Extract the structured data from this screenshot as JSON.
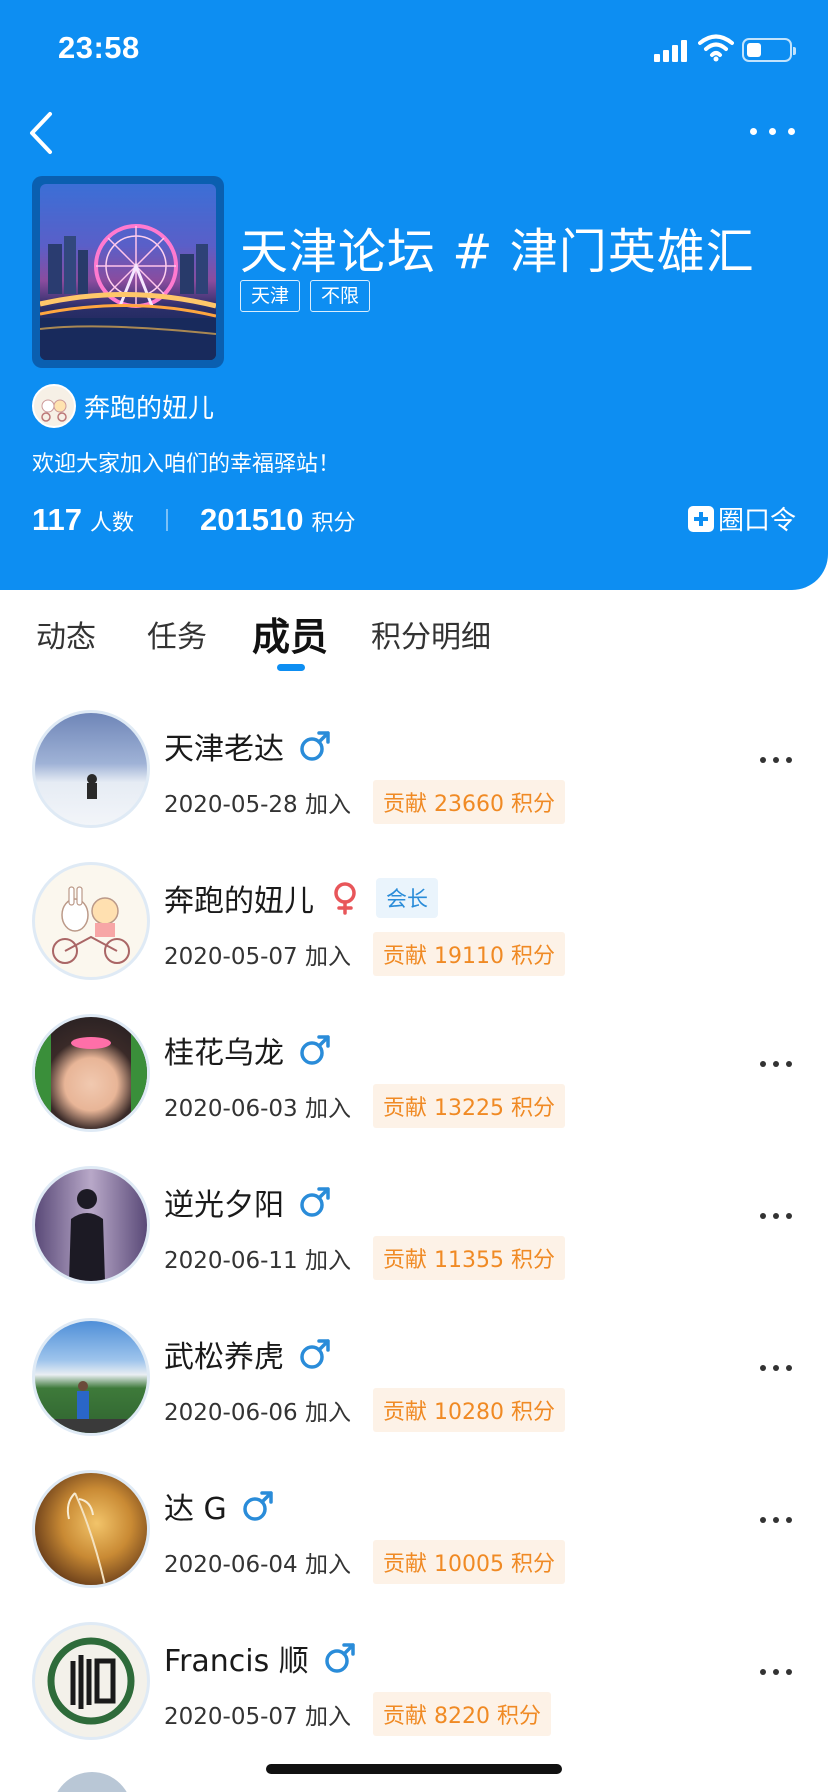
{
  "status_bar": {
    "time": "23:58"
  },
  "header": {
    "group_title": "天津论坛 # 津门英雄汇",
    "tags": [
      "天津",
      "不限"
    ],
    "owner_name": "奔跑的妞儿",
    "welcome": "欢迎大家加入咱们的幸福驿站！",
    "stats": {
      "members_count": "117",
      "members_unit": "人数",
      "points_count": "201510",
      "points_unit": "积分"
    },
    "circle_command_label": "圈口令"
  },
  "tabs": [
    "动态",
    "任务",
    "成员",
    "积分明细"
  ],
  "active_tab": "成员",
  "colors": {
    "primary": "#0d8ef2",
    "points_text": "#f08a24",
    "male": "#2a8cd9",
    "female": "#e8565a"
  },
  "members": [
    {
      "name": "天津老达",
      "gender": "male",
      "role": "",
      "join": "2020-05-28 加入",
      "points": "贡献 23660 积分",
      "has_more": true
    },
    {
      "name": "奔跑的妞儿",
      "gender": "female",
      "role": "会长",
      "join": "2020-05-07 加入",
      "points": "贡献 19110 积分",
      "has_more": false
    },
    {
      "name": "桂花乌龙",
      "gender": "male",
      "role": "",
      "join": "2020-06-03 加入",
      "points": "贡献 13225 积分",
      "has_more": true
    },
    {
      "name": "逆光夕阳",
      "gender": "male",
      "role": "",
      "join": "2020-06-11 加入",
      "points": "贡献 11355 积分",
      "has_more": true
    },
    {
      "name": "武松养虎",
      "gender": "male",
      "role": "",
      "join": "2020-06-06 加入",
      "points": "贡献 10280 积分",
      "has_more": true
    },
    {
      "name": "达 G",
      "gender": "male",
      "role": "",
      "join": "2020-06-04 加入",
      "points": "贡献 10005 积分",
      "has_more": true
    },
    {
      "name": "Francis 顺",
      "gender": "male",
      "role": "",
      "join": "2020-05-07 加入",
      "points": "贡献 8220 积分",
      "has_more": true
    }
  ]
}
